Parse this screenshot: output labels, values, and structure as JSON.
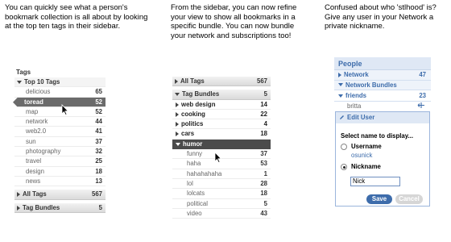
{
  "captions": {
    "left": "You can quickly see what a person's bookmark collection is all about by looking at the top ten tags in their sidebar.",
    "middle": "From the sidebar, you can now refine your view to show all bookmarks in a specific bundle. You can now bundle your network and subscriptions too!",
    "right": "Confused about who 'stlhood' is? Give any user in your Network a private nickname."
  },
  "panel_tags": {
    "title": "Tags",
    "top_ten_label": "Top 10 Tags",
    "tags": [
      {
        "name": "delicious",
        "count": "65"
      },
      {
        "name": "toread",
        "count": "52"
      },
      {
        "name": "map",
        "count": "52"
      },
      {
        "name": "network",
        "count": "44"
      },
      {
        "name": "web2.0",
        "count": "41"
      },
      {
        "name": "sun",
        "count": "37"
      },
      {
        "name": "photography",
        "count": "32"
      },
      {
        "name": "travel",
        "count": "25"
      },
      {
        "name": "design",
        "count": "18"
      },
      {
        "name": "news",
        "count": "13"
      }
    ],
    "all_tags_label": "All Tags",
    "all_tags_count": "567",
    "tag_bundles_label": "Tag Bundles",
    "tag_bundles_count": "5"
  },
  "panel_bundles": {
    "all_tags_label": "All Tags",
    "all_tags_count": "567",
    "tag_bundles_label": "Tag Bundles",
    "tag_bundles_count": "5",
    "bundles": [
      {
        "name": "web design",
        "count": "14"
      },
      {
        "name": "cooking",
        "count": "22"
      },
      {
        "name": "politics",
        "count": "4"
      },
      {
        "name": "cars",
        "count": "18"
      }
    ],
    "open_bundle": "humor",
    "humor_tags": [
      {
        "name": "funny",
        "count": "37"
      },
      {
        "name": "haha",
        "count": "53"
      },
      {
        "name": "hahahahaha",
        "count": "1"
      },
      {
        "name": "lol",
        "count": "28"
      },
      {
        "name": "lolcats",
        "count": "18"
      },
      {
        "name": "political",
        "count": "5"
      },
      {
        "name": "video",
        "count": "43"
      }
    ]
  },
  "panel_people": {
    "title": "People",
    "network_label": "Network",
    "network_count": "47",
    "network_bundles_label": "Network Bundles",
    "friends_label": "friends",
    "friends_count": "23",
    "user": "britta",
    "edit_title": "Edit User",
    "select_label": "Select name to display...",
    "username_label": "Username",
    "username_value": "osunick",
    "nickname_label": "Nickname",
    "nickname_value": "Nick",
    "save_label": "Save",
    "cancel_label": "Cancel"
  },
  "colors": {
    "accent": "#3d6cab",
    "selected_row": "#6b6b6b",
    "humor_row": "#4b4b4b",
    "people_header_bg": "#dfe8f5"
  }
}
